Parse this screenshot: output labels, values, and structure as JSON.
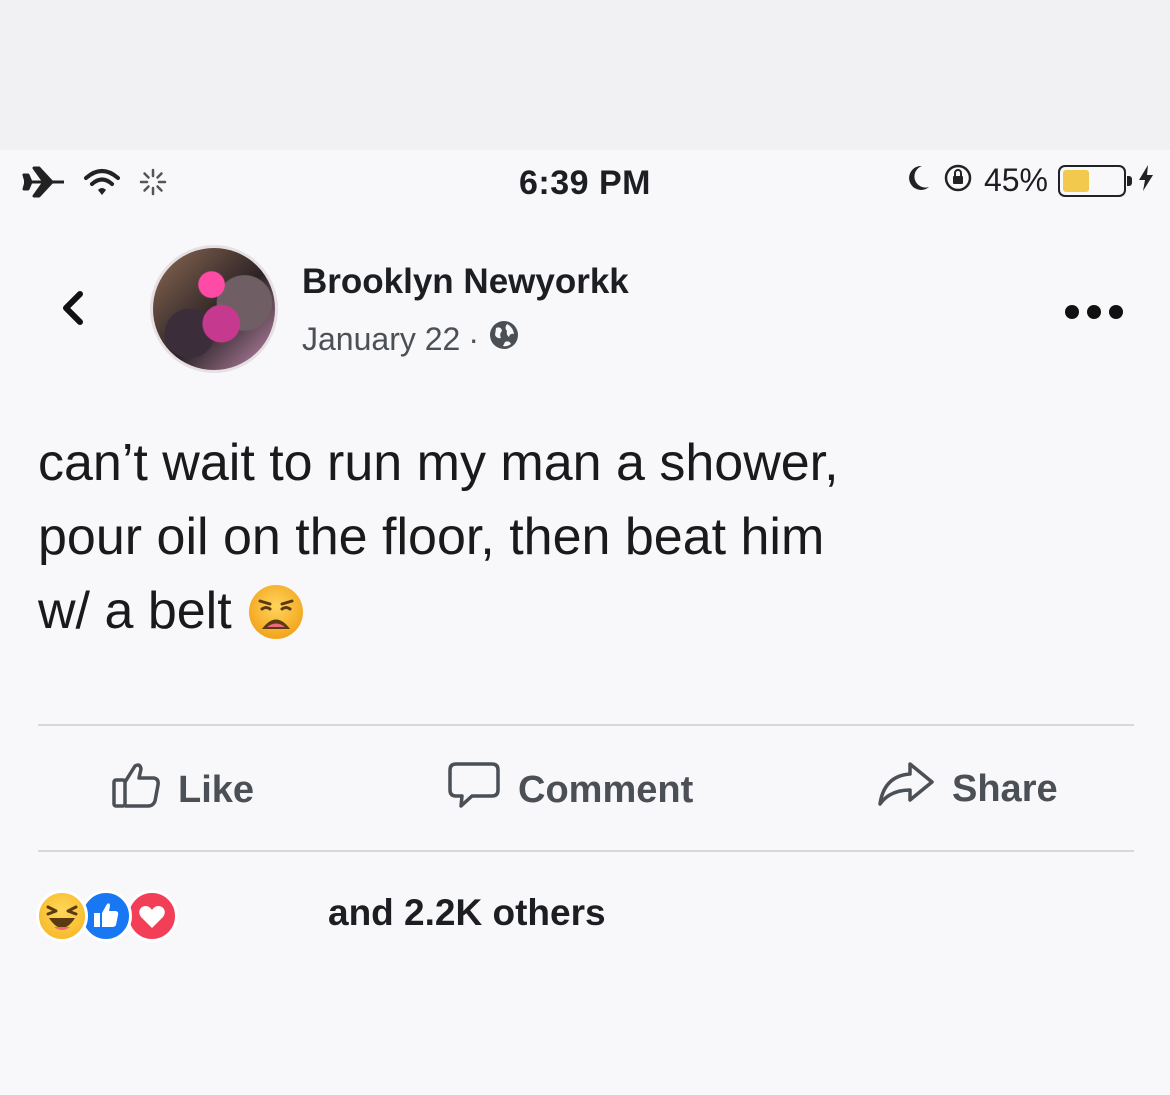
{
  "status_bar": {
    "time": "6:39 PM",
    "battery_percent_label": "45%",
    "battery_level": 0.45,
    "icons": [
      "airplane-icon",
      "wifi-icon",
      "activity-spinner-icon",
      "moon-icon",
      "orientation-lock-icon",
      "battery-icon",
      "charging-bolt-icon"
    ]
  },
  "post": {
    "author_name": "Brooklyn Newyorkk",
    "date": "January 22",
    "separator": "·",
    "privacy_icon": "globe-icon",
    "text": "can’t wait to run my man a shower,\npour oil on the floor, then beat him\nw/ a belt",
    "text_emoji": "weary-face-emoji"
  },
  "actions": {
    "like_label": "Like",
    "comment_label": "Comment",
    "share_label": "Share"
  },
  "reactions": {
    "icons": [
      "haha-reaction-icon",
      "like-reaction-icon",
      "love-reaction-icon"
    ],
    "summary": "and 2.2K others"
  },
  "colors": {
    "background": "#f8f8fa",
    "text": "#1c1e21",
    "secondary_text": "#4b4f56",
    "like_blue": "#1877f2",
    "love_red": "#f33e58",
    "haha_yellow": "#f5b11e",
    "battery_yellow": "#f2c94c"
  }
}
